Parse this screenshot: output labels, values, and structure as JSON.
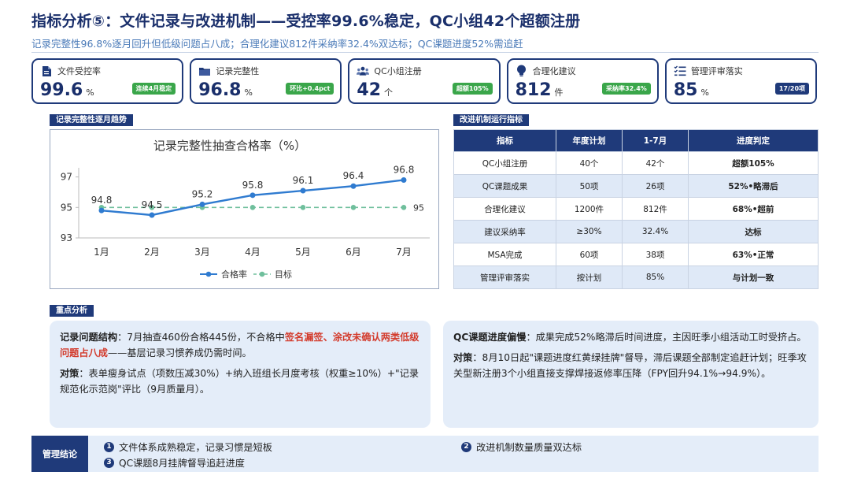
{
  "title": "指标分析⑤：文件记录与改进机制——受控率99.6%稳定，QC小组42个超额注册",
  "subtitle": "记录完整性96.8%逐月回升但低级问题占八成；合理化建议812件采纳率32.4%双达标；QC课题进度52%需追赶",
  "kpis": [
    {
      "icon": "document-icon",
      "label": "文件受控率",
      "value": "99.6",
      "unit": "%",
      "badge": "连续4月稳定",
      "badge_color": "green"
    },
    {
      "icon": "folder-icon",
      "label": "记录完整性",
      "value": "96.8",
      "unit": "%",
      "badge": "环比+0.4pct",
      "badge_color": "green"
    },
    {
      "icon": "people-icon",
      "label": "QC小组注册",
      "value": "42",
      "unit": "个",
      "badge": "超额105%",
      "badge_color": "green"
    },
    {
      "icon": "lightbulb-icon",
      "label": "合理化建议",
      "value": "812",
      "unit": "件",
      "badge": "采纳率32.4%",
      "badge_color": "green"
    },
    {
      "icon": "checklist-icon",
      "label": "管理评审落实",
      "value": "85",
      "unit": "%",
      "badge": "17/20项",
      "badge_color": "navy"
    }
  ],
  "chart_section_label": "记录完整性逐月趋势",
  "chart_data": {
    "type": "line",
    "title": "记录完整性抽查合格率（%）",
    "categories": [
      "1月",
      "2月",
      "3月",
      "4月",
      "5月",
      "6月",
      "7月"
    ],
    "series": [
      {
        "name": "合格率",
        "values": [
          94.8,
          94.5,
          95.2,
          95.8,
          96.1,
          96.4,
          96.8
        ],
        "color": "#2f7bd0"
      },
      {
        "name": "目标",
        "values": [
          95,
          95,
          95,
          95,
          95,
          95,
          95
        ],
        "color": "#6fbf9c"
      }
    ],
    "yticks": [
      93,
      95,
      97
    ],
    "ylim": [
      93,
      97.6
    ],
    "target_end_label": "95"
  },
  "table_section_label": "改进机制运行指标",
  "table": {
    "headers": [
      "指标",
      "年度计划",
      "1-7月",
      "进度判定"
    ],
    "rows": [
      {
        "cells": [
          "QC小组注册",
          "40个",
          "42个",
          "超额105%"
        ],
        "status": "good"
      },
      {
        "cells": [
          "QC课题成果",
          "50项",
          "26项",
          "52%•略滞后"
        ],
        "status": "warn"
      },
      {
        "cells": [
          "合理化建议",
          "1200件",
          "812件",
          "68%•超前"
        ],
        "status": "good"
      },
      {
        "cells": [
          "建议采纳率",
          "≥30%",
          "32.4%",
          "达标"
        ],
        "status": "good"
      },
      {
        "cells": [
          "MSA完成",
          "60项",
          "38项",
          "63%•正常"
        ],
        "status": "good"
      },
      {
        "cells": [
          "管理评审落实",
          "按计划",
          "85%",
          "与计划一致"
        ],
        "status": "good"
      }
    ]
  },
  "analysis_label": "重点分析",
  "left_card": {
    "p1_lead": "记录问题结构",
    "p1_text_a": "：7月抽查460份合格445份，不合格中",
    "p1_highlight": "签名漏签、涂改未确认两类低级问题占八成",
    "p1_text_b": "——基层记录习惯养成仍需时间。",
    "p2_lead": "对策",
    "p2_text": "：表单瘦身试点（项数压减30%）+纳入班组长月度考核（权重≥10%）+\"记录规范化示范岗\"评比（9月质量月）。"
  },
  "right_card": {
    "p1_lead": "QC课题进度偏慢",
    "p1_text": "：成果完成52%略滞后时间进度，主因旺季小组活动工时受挤占。",
    "p2_lead": "对策",
    "p2_text": "：8月10日起\"课题进度红黄绿挂牌\"督导，滞后课题全部制定追赶计划；旺季攻关型新注册3个小组直接支撑焊接返修率压降（FPY回升94.1%→94.9%）。"
  },
  "conclusion": {
    "label": "管理结论",
    "items": [
      {
        "num": "1",
        "text": "文件体系成熟稳定，记录习惯是短板"
      },
      {
        "num": "2",
        "text": "改进机制数量质量双达标"
      },
      {
        "num": "3",
        "text": "QC课题8月挂牌督导追赶进度"
      }
    ]
  },
  "colors": {
    "navy": "#1f3a7a",
    "accent_blue": "#2f7bd0",
    "good": "#2e9a3a",
    "warn": "#e98a2b",
    "red": "#d33b2c",
    "card_bg": "#e4edf9"
  }
}
